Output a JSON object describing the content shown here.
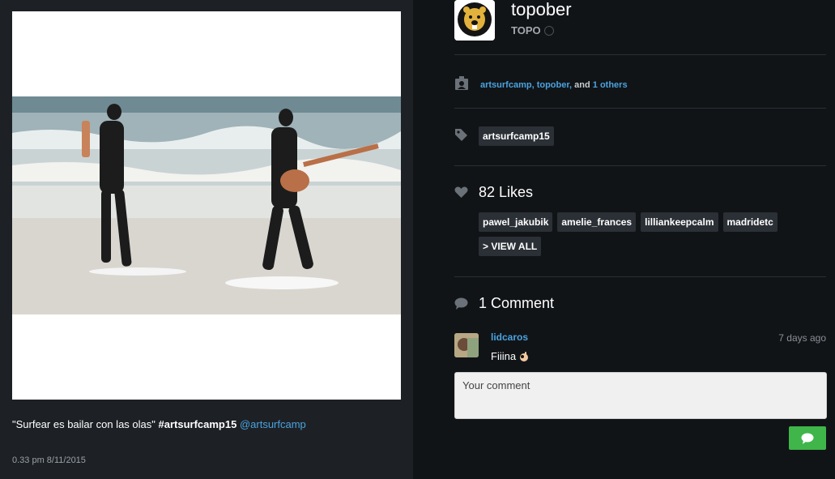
{
  "post": {
    "caption_quote": "\"Surfear es bailar con las olas\"",
    "caption_hashtag": "#artsurfcamp15",
    "caption_mention": "@artsurfcamp",
    "timestamp": "0.33 pm 8/11/2015"
  },
  "profile": {
    "username": "topober",
    "full_name": "TOPO",
    "avatar_icon": "cartoon-beaver-icon"
  },
  "tagged": {
    "user1": "artsurfcamp,",
    "user2": "topober,",
    "and_text": "and",
    "others": "1 others"
  },
  "hashtags": [
    "artsurfcamp15"
  ],
  "likes": {
    "count_label": "82 Likes",
    "likers": [
      "pawel_jakubik",
      "amelie_frances",
      "lilliankeepcalm",
      "madridetc"
    ],
    "view_all_label": "> VIEW ALL"
  },
  "comments": {
    "count_label": "1 Comment",
    "items": [
      {
        "user": "lidcaros",
        "time": "7 days ago",
        "text": "Fiiina"
      }
    ],
    "input_placeholder": "Your comment"
  },
  "colors": {
    "link": "#4aa3df",
    "send_button": "#3fb54a"
  }
}
